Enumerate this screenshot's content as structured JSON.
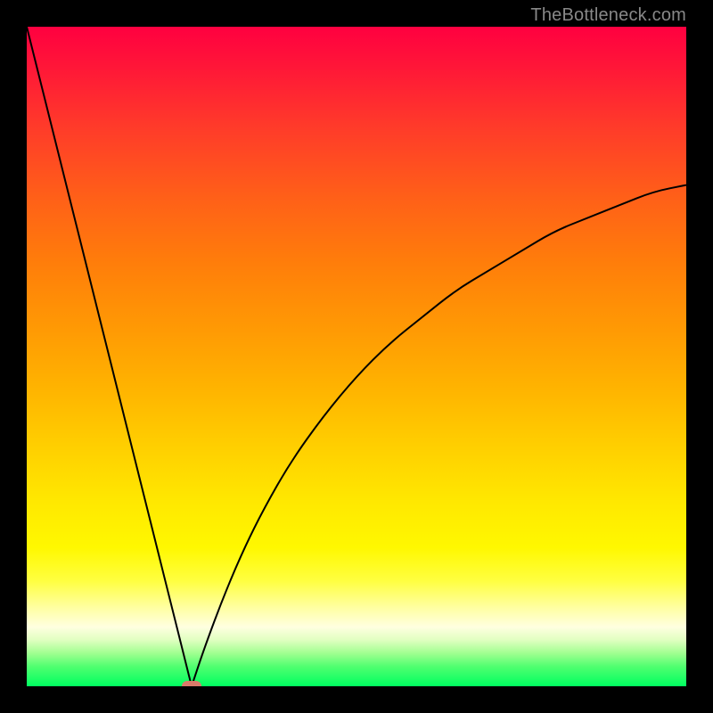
{
  "watermark": "TheBottleneck.com",
  "colors": {
    "frame": "#000000",
    "curve": "#000000",
    "marker": "#d97a6a",
    "gradient_top": "#ff0040",
    "gradient_bottom": "#00ff60",
    "watermark_text": "#888888"
  },
  "chart_data": {
    "type": "line",
    "title": "",
    "xlabel": "",
    "ylabel": "",
    "xlim": [
      0,
      100
    ],
    "ylim": [
      0,
      100
    ],
    "grid": false,
    "legend": false,
    "annotations": [
      "TheBottleneck.com"
    ],
    "description": "Two curved branches forming a V. They meet near x≈25 at y≈0 (a small marker there). Left branch rises steeply to ~100 at x=0; right branch rises with decreasing slope to ~76 at x=100.",
    "left_branch": {
      "x": [
        0,
        2,
        4,
        6,
        8,
        10,
        12,
        14,
        16,
        18,
        20,
        22,
        24,
        25
      ],
      "y": [
        100,
        92,
        84,
        76,
        68,
        60,
        52,
        44,
        36,
        28,
        20,
        12,
        4,
        0
      ]
    },
    "right_branch": {
      "x": [
        25,
        27,
        30,
        33,
        36,
        40,
        45,
        50,
        55,
        60,
        65,
        70,
        75,
        80,
        85,
        90,
        95,
        100
      ],
      "y": [
        0,
        6,
        14,
        21,
        27,
        34,
        41,
        47,
        52,
        56,
        60,
        63,
        66,
        69,
        71,
        73,
        75,
        76
      ]
    },
    "marker": {
      "x": 25,
      "y": 0,
      "width": 3,
      "height": 1.5
    }
  }
}
